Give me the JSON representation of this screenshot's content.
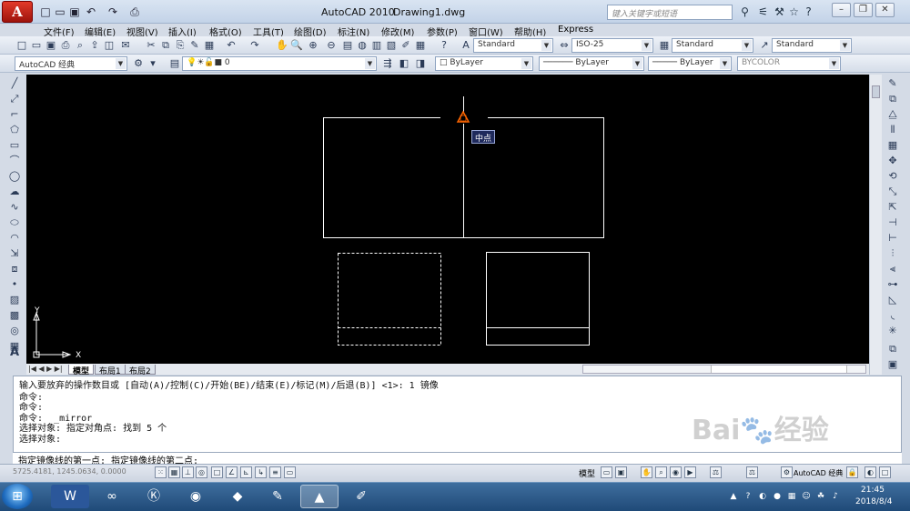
{
  "window": {
    "app_title": "AutoCAD 2010",
    "doc_title": "Drawing1.dwg",
    "search_placeholder": "键入关键字或短语",
    "app_button": "A"
  },
  "menus": [
    "文件(F)",
    "编辑(E)",
    "视图(V)",
    "插入(I)",
    "格式(O)",
    "工具(T)",
    "绘图(D)",
    "标注(N)",
    "修改(M)",
    "参数(P)",
    "窗口(W)",
    "帮助(H)",
    "Express"
  ],
  "styles": {
    "text_style": "Standard",
    "dim_style": "ISO-25",
    "table_style": "Standard",
    "multileader_style": "Standard"
  },
  "workspace": "AutoCAD 经典",
  "layer": {
    "name": "0"
  },
  "properties": {
    "color": "ByLayer",
    "linetype": "ByLayer",
    "lineweight": "ByLayer",
    "plotstyle": "BYCOLOR"
  },
  "snap_tooltip": "中点",
  "ucs": {
    "x": "X",
    "y": "Y"
  },
  "tabs": [
    "模型",
    "布局1",
    "布局2"
  ],
  "command_history": [
    "输入要放弃的操作数目或 [自动(A)/控制(C)/开始(BE)/结束(E)/标记(M)/后退(B)] <1>: 1 镜像",
    "命令:",
    "命令:",
    "命令:  _mirror",
    "选择对象: 指定对角点: 找到 5 个",
    "选择对象:"
  ],
  "command_prompt": "指定镜像线的第一点: 指定镜像线的第二点:",
  "status": {
    "coords": "5725.4181, 1245.0634, 0.0000",
    "model_label": "模型",
    "workspace_label": "AutoCAD 经典"
  },
  "taskbar": {
    "time": "21:45",
    "date": "2018/8/4"
  },
  "colors": {
    "canvas": "#000000",
    "entity": "#ffffff",
    "snap_marker": "#ff6600",
    "tooltip_bg": "#1f2a5c"
  }
}
